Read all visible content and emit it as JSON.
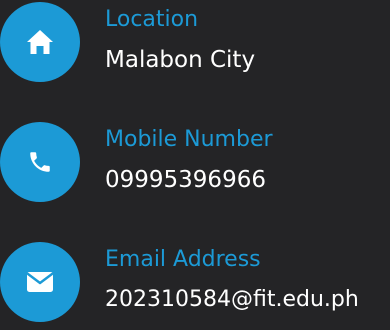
{
  "colors": {
    "background": "#242426",
    "accent": "#1c9ad6",
    "value_text": "#ffffff"
  },
  "contacts": [
    {
      "icon": "home-icon",
      "label": "Location",
      "value": "Malabon City"
    },
    {
      "icon": "phone-icon",
      "label": "Mobile Number",
      "value": "09995396966"
    },
    {
      "icon": "envelope-icon",
      "label": "Email Address",
      "value": "202310584@fit.edu.ph"
    }
  ]
}
